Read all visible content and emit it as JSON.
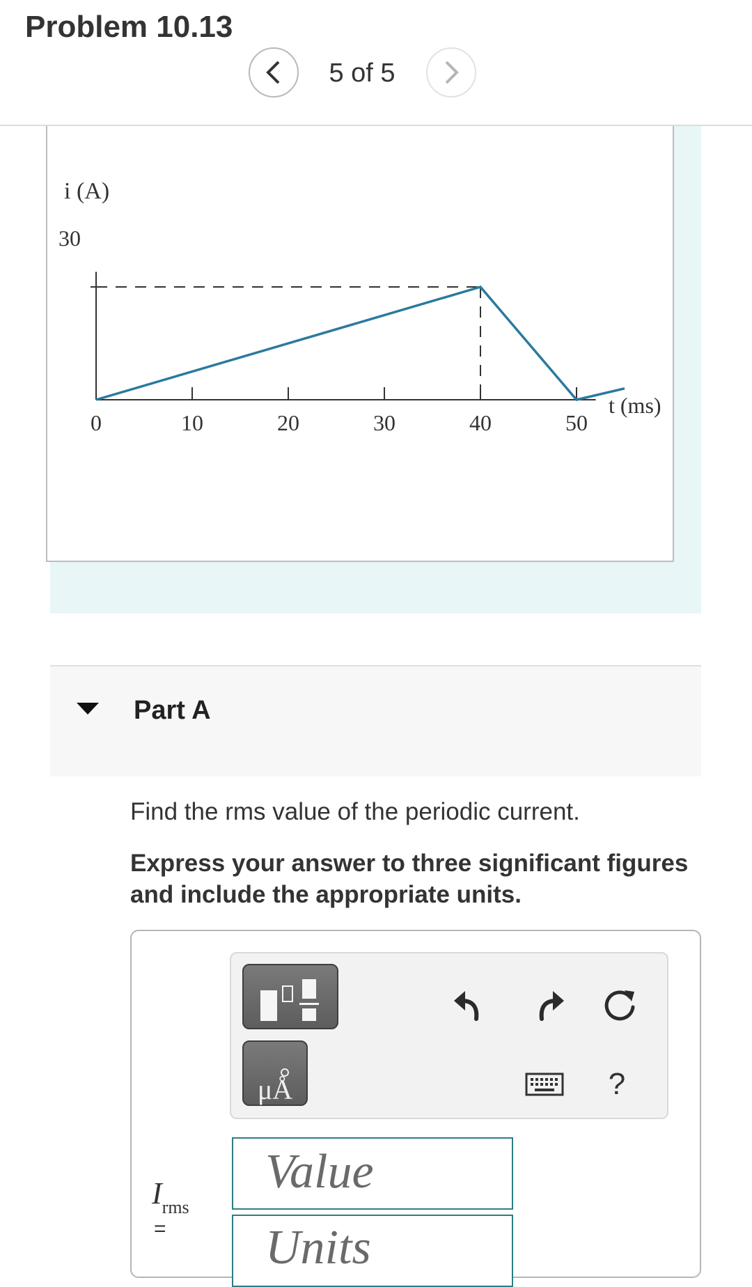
{
  "problem": {
    "title": "Problem 10.13"
  },
  "pager": {
    "text": "5 of 5",
    "prev_icon": "chevron-left-icon",
    "next_icon": "chevron-right-icon"
  },
  "figure": {
    "y_axis_label": "i (A)",
    "x_axis_label": "t (ms)",
    "y_tick_label": "30",
    "x_tick_labels": [
      "0",
      "10",
      "20",
      "30",
      "40",
      "50"
    ],
    "line_color": "#2a7a9e"
  },
  "chart_data": {
    "type": "line",
    "xlabel": "t (ms)",
    "ylabel": "i (A)",
    "x": [
      0,
      40,
      50,
      55
    ],
    "values": [
      0,
      30,
      0,
      3
    ],
    "guides": {
      "horizontal_dashed_at": 30,
      "vertical_dashed_at": 40
    },
    "xticks": [
      0,
      10,
      20,
      30,
      40,
      50
    ],
    "yticks": [
      30
    ],
    "xlim": [
      0,
      58
    ],
    "ylim": [
      0,
      34
    ]
  },
  "part": {
    "title": "Part A",
    "caret_icon": "caret-down-icon"
  },
  "question": "Find the rms value of the periodic current.",
  "instruction": "Express your answer to three significant figures and include the appropriate units.",
  "toolbar": {
    "units_label": "μÅ",
    "icons": [
      "templates-icon",
      "units-icon",
      "undo-icon",
      "redo-icon",
      "reset-icon",
      "keyboard-icon",
      "help-icon"
    ],
    "help_label": "?"
  },
  "answer": {
    "label_main": "I",
    "label_sub": "rms",
    "equals": "=",
    "value_placeholder": "Value",
    "units_placeholder": "Units"
  }
}
